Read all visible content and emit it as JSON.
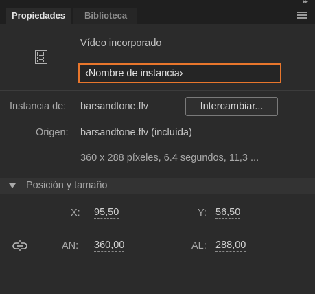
{
  "tabs": [
    {
      "label": "Propiedades",
      "active": true
    },
    {
      "label": "Biblioteca",
      "active": false
    }
  ],
  "header": {
    "collapse_icon": "double-chevron-right-icon",
    "menu_icon": "panel-menu-icon"
  },
  "object": {
    "icon": "film-strip-icon",
    "type_label": "Vídeo incorporado",
    "instance_name_placeholder": "‹Nombre de instancia›"
  },
  "details": {
    "instance_label": "Instancia de:",
    "instance_value": "barsandtone.flv",
    "swap_button": "Intercambiar...",
    "origin_label": "Origen:",
    "origin_value": "barsandtone.flv (incluída)",
    "info": "360 x 288 píxeles, 6.4 segundos, 11,3 ..."
  },
  "position_size": {
    "title": "Posición y tamaño",
    "x_label": "X:",
    "x_value": "95,50",
    "y_label": "Y:",
    "y_value": "56,50",
    "w_label": "AN:",
    "w_value": "360,00",
    "h_label": "AL:",
    "h_value": "288,00",
    "link_icon": "link-proportions-icon"
  },
  "colors": {
    "panel_bg": "#2b2b2b",
    "tab_bar_bg": "#1f1f1f",
    "focus_accent": "#e8762c"
  }
}
